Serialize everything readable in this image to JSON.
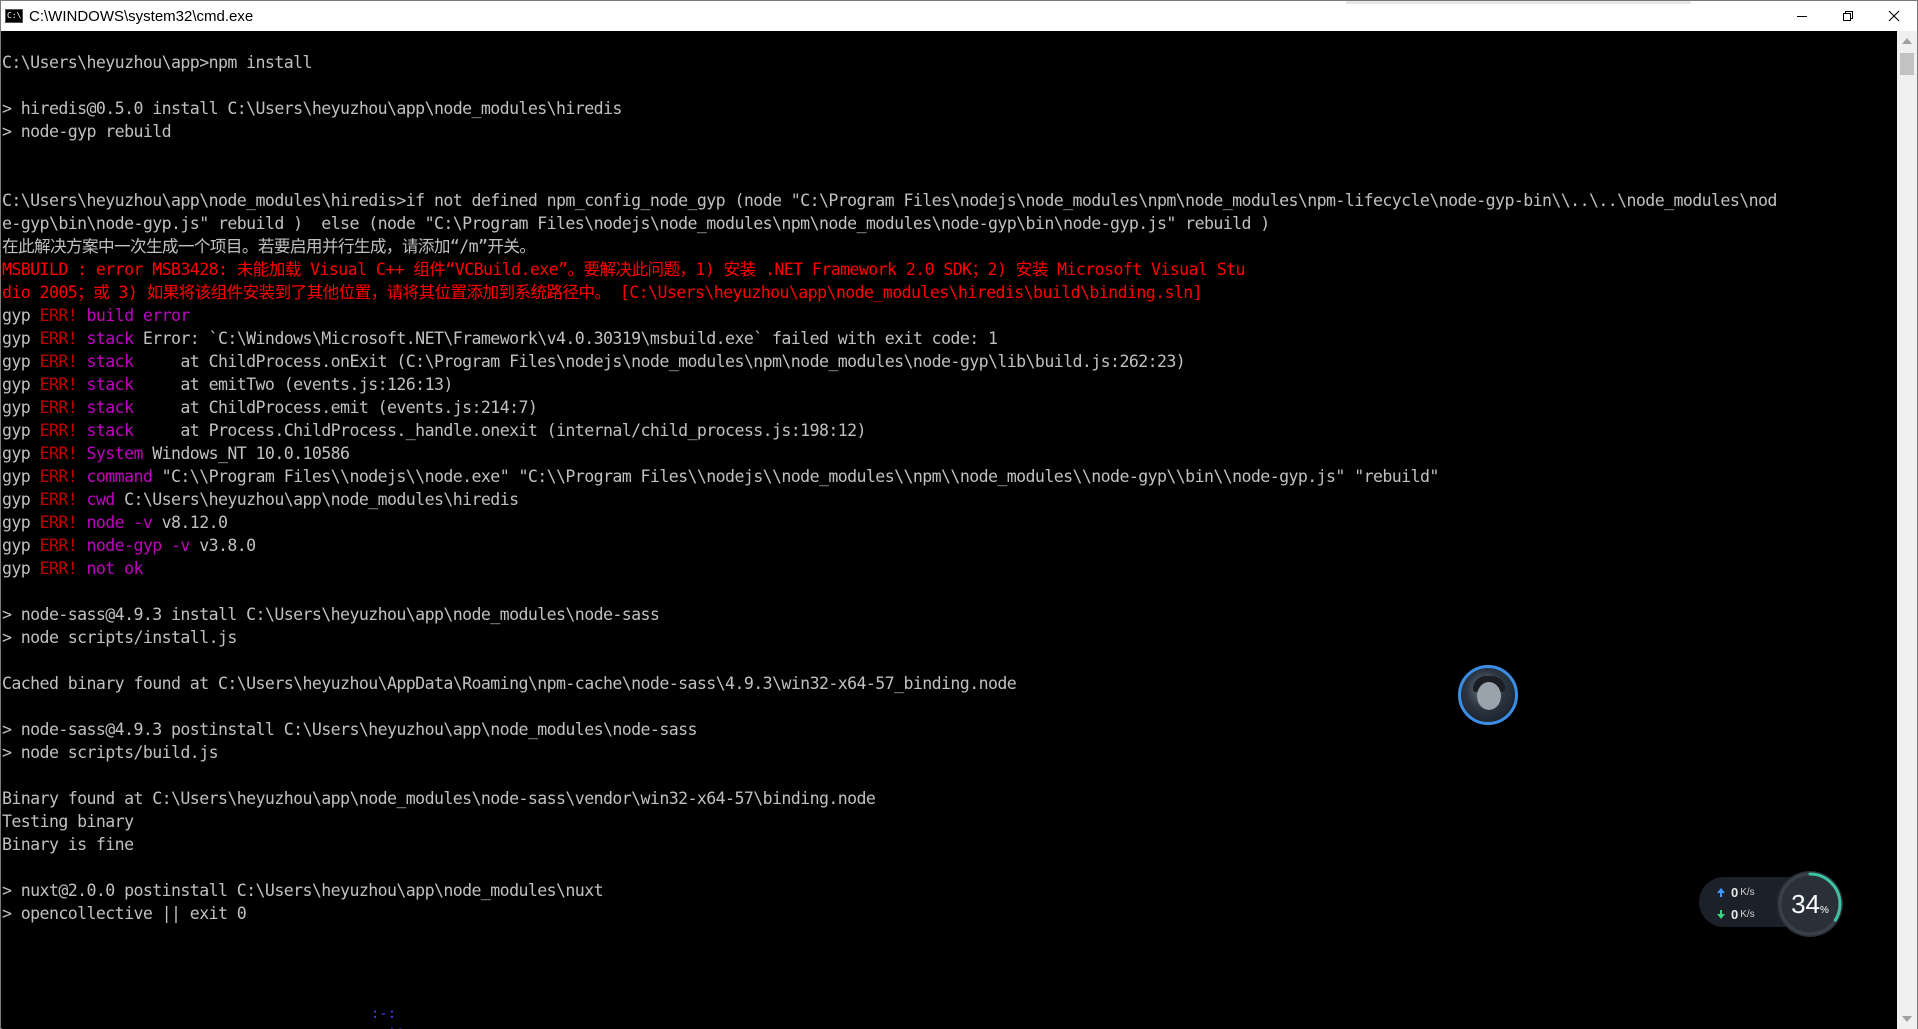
{
  "window": {
    "title": "C:\\WINDOWS\\system32\\cmd.exe",
    "icon": "cmd-icon",
    "controls": [
      "minimize-icon",
      "restore-icon",
      "close-icon"
    ]
  },
  "console": {
    "lines": [
      {
        "segments": [
          {
            "t": "C:\\Users\\heyuzhou\\app>npm install",
            "c": ""
          }
        ]
      },
      {
        "segments": [
          {
            "t": "",
            "c": ""
          }
        ]
      },
      {
        "segments": [
          {
            "t": "> hiredis@0.5.0 install C:\\Users\\heyuzhou\\app\\node_modules\\hiredis",
            "c": ""
          }
        ]
      },
      {
        "segments": [
          {
            "t": "> node-gyp rebuild",
            "c": ""
          }
        ]
      },
      {
        "segments": [
          {
            "t": "",
            "c": ""
          }
        ]
      },
      {
        "segments": [
          {
            "t": "",
            "c": ""
          }
        ]
      },
      {
        "segments": [
          {
            "t": "C:\\Users\\heyuzhou\\app\\node_modules\\hiredis>if not defined npm_config_node_gyp (node \"C:\\Program Files\\nodejs\\node_modules\\npm\\node_modules\\npm-lifecycle\\node-gyp-bin\\\\..\\..\\node_modules\\nod",
            "c": ""
          }
        ]
      },
      {
        "segments": [
          {
            "t": "e-gyp\\bin\\node-gyp.js\" rebuild )  else (node \"C:\\Program Files\\nodejs\\node_modules\\npm\\node_modules\\node-gyp\\bin\\node-gyp.js\" rebuild )",
            "c": ""
          }
        ]
      },
      {
        "segments": [
          {
            "t": "在此解决方案中一次生成一个项目。若要启用并行生成，请添加“/m”开关。",
            "c": ""
          }
        ]
      },
      {
        "segments": [
          {
            "t": "MSBUILD : error MSB3428: 未能加载 Visual C++ 组件“VCBuild.exe”。要解决此问题，1) 安装 .NET Framework 2.0 SDK；2) 安装 Microsoft Visual Stu",
            "c": "red"
          }
        ]
      },
      {
        "segments": [
          {
            "t": "dio 2005；或 3) 如果将该组件安装到了其他位置，请将其位置添加到系统路径中。 [C:\\Users\\heyuzhou\\app\\node_modules\\hiredis\\build\\binding.sln]",
            "c": "red"
          }
        ]
      },
      {
        "segments": [
          {
            "t": "gyp ",
            "c": ""
          },
          {
            "t": "ERR!",
            "c": "dkred"
          },
          {
            "t": " ",
            "c": ""
          },
          {
            "t": "build error",
            "c": "magenta"
          }
        ]
      },
      {
        "segments": [
          {
            "t": "gyp ",
            "c": ""
          },
          {
            "t": "ERR!",
            "c": "dkred"
          },
          {
            "t": " ",
            "c": ""
          },
          {
            "t": "stack",
            "c": "magenta"
          },
          {
            "t": " Error: `C:\\Windows\\Microsoft.NET\\Framework\\v4.0.30319\\msbuild.exe` failed with exit code: 1",
            "c": ""
          }
        ]
      },
      {
        "segments": [
          {
            "t": "gyp ",
            "c": ""
          },
          {
            "t": "ERR!",
            "c": "dkred"
          },
          {
            "t": " ",
            "c": ""
          },
          {
            "t": "stack",
            "c": "magenta"
          },
          {
            "t": "     at ChildProcess.onExit (C:\\Program Files\\nodejs\\node_modules\\npm\\node_modules\\node-gyp\\lib\\build.js:262:23)",
            "c": ""
          }
        ]
      },
      {
        "segments": [
          {
            "t": "gyp ",
            "c": ""
          },
          {
            "t": "ERR!",
            "c": "dkred"
          },
          {
            "t": " ",
            "c": ""
          },
          {
            "t": "stack",
            "c": "magenta"
          },
          {
            "t": "     at emitTwo (events.js:126:13)",
            "c": ""
          }
        ]
      },
      {
        "segments": [
          {
            "t": "gyp ",
            "c": ""
          },
          {
            "t": "ERR!",
            "c": "dkred"
          },
          {
            "t": " ",
            "c": ""
          },
          {
            "t": "stack",
            "c": "magenta"
          },
          {
            "t": "     at ChildProcess.emit (events.js:214:7)",
            "c": ""
          }
        ]
      },
      {
        "segments": [
          {
            "t": "gyp ",
            "c": ""
          },
          {
            "t": "ERR!",
            "c": "dkred"
          },
          {
            "t": " ",
            "c": ""
          },
          {
            "t": "stack",
            "c": "magenta"
          },
          {
            "t": "     at Process.ChildProcess._handle.onexit (internal/child_process.js:198:12)",
            "c": ""
          }
        ]
      },
      {
        "segments": [
          {
            "t": "gyp ",
            "c": ""
          },
          {
            "t": "ERR!",
            "c": "dkred"
          },
          {
            "t": " ",
            "c": ""
          },
          {
            "t": "System",
            "c": "magenta"
          },
          {
            "t": " Windows_NT 10.0.10586",
            "c": ""
          }
        ]
      },
      {
        "segments": [
          {
            "t": "gyp ",
            "c": ""
          },
          {
            "t": "ERR!",
            "c": "dkred"
          },
          {
            "t": " ",
            "c": ""
          },
          {
            "t": "command",
            "c": "magenta"
          },
          {
            "t": " \"C:\\\\Program Files\\\\nodejs\\\\node.exe\" \"C:\\\\Program Files\\\\nodejs\\\\node_modules\\\\npm\\\\node_modules\\\\node-gyp\\\\bin\\\\node-gyp.js\" \"rebuild\"",
            "c": ""
          }
        ]
      },
      {
        "segments": [
          {
            "t": "gyp ",
            "c": ""
          },
          {
            "t": "ERR!",
            "c": "dkred"
          },
          {
            "t": " ",
            "c": ""
          },
          {
            "t": "cwd",
            "c": "magenta"
          },
          {
            "t": " C:\\Users\\heyuzhou\\app\\node_modules\\hiredis",
            "c": ""
          }
        ]
      },
      {
        "segments": [
          {
            "t": "gyp ",
            "c": ""
          },
          {
            "t": "ERR!",
            "c": "dkred"
          },
          {
            "t": " ",
            "c": ""
          },
          {
            "t": "node -v",
            "c": "magenta"
          },
          {
            "t": " v8.12.0",
            "c": ""
          }
        ]
      },
      {
        "segments": [
          {
            "t": "gyp ",
            "c": ""
          },
          {
            "t": "ERR!",
            "c": "dkred"
          },
          {
            "t": " ",
            "c": ""
          },
          {
            "t": "node-gyp -v",
            "c": "magenta"
          },
          {
            "t": " v3.8.0",
            "c": ""
          }
        ]
      },
      {
        "segments": [
          {
            "t": "gyp ",
            "c": ""
          },
          {
            "t": "ERR!",
            "c": "dkred"
          },
          {
            "t": " ",
            "c": ""
          },
          {
            "t": "not ok",
            "c": "magenta"
          }
        ]
      },
      {
        "segments": [
          {
            "t": "",
            "c": ""
          }
        ]
      },
      {
        "segments": [
          {
            "t": "> node-sass@4.9.3 install C:\\Users\\heyuzhou\\app\\node_modules\\node-sass",
            "c": ""
          }
        ]
      },
      {
        "segments": [
          {
            "t": "> node scripts/install.js",
            "c": ""
          }
        ]
      },
      {
        "segments": [
          {
            "t": "",
            "c": ""
          }
        ]
      },
      {
        "segments": [
          {
            "t": "Cached binary found at C:\\Users\\heyuzhou\\AppData\\Roaming\\npm-cache\\node-sass\\4.9.3\\win32-x64-57_binding.node",
            "c": ""
          }
        ]
      },
      {
        "segments": [
          {
            "t": "",
            "c": ""
          }
        ]
      },
      {
        "segments": [
          {
            "t": "> node-sass@4.9.3 postinstall C:\\Users\\heyuzhou\\app\\node_modules\\node-sass",
            "c": ""
          }
        ]
      },
      {
        "segments": [
          {
            "t": "> node scripts/build.js",
            "c": ""
          }
        ]
      },
      {
        "segments": [
          {
            "t": "",
            "c": ""
          }
        ]
      },
      {
        "segments": [
          {
            "t": "Binary found at C:\\Users\\heyuzhou\\app\\node_modules\\node-sass\\vendor\\win32-x64-57\\binding.node",
            "c": ""
          }
        ]
      },
      {
        "segments": [
          {
            "t": "Testing binary",
            "c": ""
          }
        ]
      },
      {
        "segments": [
          {
            "t": "Binary is fine",
            "c": ""
          }
        ]
      },
      {
        "segments": [
          {
            "t": "",
            "c": ""
          }
        ]
      },
      {
        "segments": [
          {
            "t": "> nuxt@2.0.0 postinstall C:\\Users\\heyuzhou\\app\\node_modules\\nuxt",
            "c": ""
          }
        ]
      },
      {
        "segments": [
          {
            "t": "> opencollective || exit 0",
            "c": ""
          }
        ]
      }
    ],
    "spinner_art": "  :-:\n.==-+:"
  },
  "netwidget": {
    "upload_value": "0",
    "upload_unit": "K/s",
    "download_value": "0",
    "download_unit": "K/s",
    "percent_value": "34",
    "percent_unit": "%",
    "percent_fraction": 0.34,
    "ring_color": "#3fc1a4"
  },
  "colors": {
    "console_bg": "#000000",
    "console_fg": "#c0c0c0",
    "error_red": "#ff0000",
    "err_label": "#c00000",
    "err_key": "#c000c0"
  }
}
